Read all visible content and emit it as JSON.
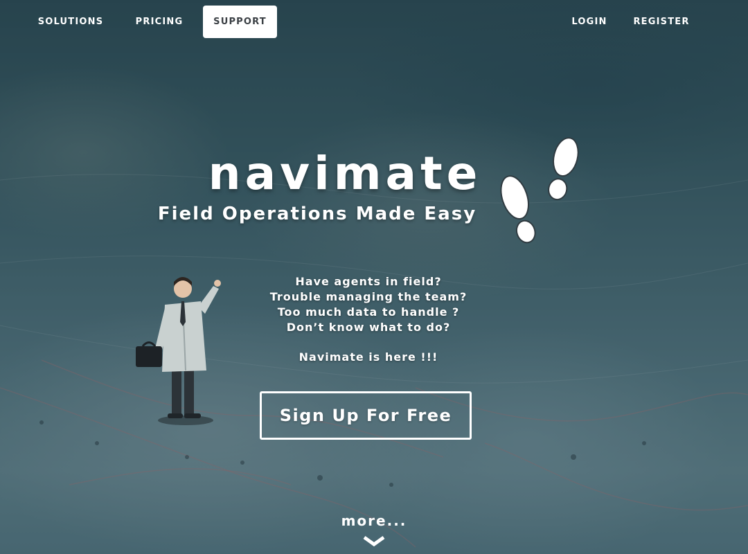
{
  "nav": {
    "left": [
      {
        "label": "SOLUTIONS",
        "active": false
      },
      {
        "label": "PRICING",
        "active": false
      },
      {
        "label": "SUPPORT",
        "active": true
      }
    ],
    "right": [
      {
        "label": "LOGIN"
      },
      {
        "label": "REGISTER"
      }
    ]
  },
  "hero": {
    "brand": "navimate",
    "tagline": "Field Operations Made Easy",
    "footprints_icon": "footprints-icon",
    "questions": [
      "Have agents in field?",
      "Trouble managing the team?",
      "Too much data to handle ?",
      "Don’t know what to do?"
    ],
    "answer": "Navimate is here !!!",
    "cta_label": "Sign Up For Free"
  },
  "footer": {
    "more_label": "more...",
    "chevron_icon": "chevron-down-icon"
  },
  "colors": {
    "text": "#ffffff",
    "active_nav_bg": "#ffffff",
    "active_nav_text": "#3a3f44",
    "overlay": "#19374680"
  }
}
